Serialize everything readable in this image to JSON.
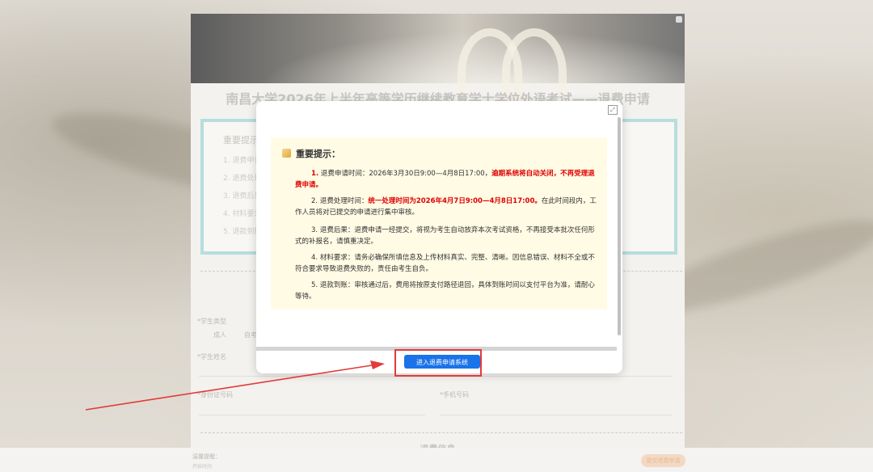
{
  "page": {
    "title": "南昌大学2026年上半年高等学历继续教育学士学位外语考试——退费申请",
    "notice_title": "重要提示：",
    "notice_lines": [
      "1. 退费申请时间",
      "2. 退费处理时间",
      "3. 退费后果",
      "4. 材料要求",
      "5. 退款到账"
    ],
    "field_student_type": "*学生类型",
    "field_student_type_options": [
      "成人",
      "自考"
    ],
    "field_student_name": "*学生姓名",
    "field_id_number": "*身份证号码",
    "field_phone": "*手机号码",
    "section_refund_info": "退费信息",
    "footer_line1": "温馨提醒：",
    "footer_line2": "开始时间",
    "footer_button": "提交退费申请"
  },
  "modal": {
    "heading": "重要提示：",
    "items": [
      {
        "num": "1.",
        "label": "退费申请时间：",
        "text": "2026年3月30日9:00—4月8日17:00，",
        "red": "逾期系统将自动关闭，不再受理退费申请。",
        "tail": ""
      },
      {
        "num": "2.",
        "label": "退费处理时间：",
        "text": "",
        "red": "统一处理时间为2026年4月7日9:00—4月8日17:00。",
        "tail": "在此时间段内，工作人员将对已提交的申请进行集中审核。"
      },
      {
        "num": "3.",
        "label": "退费后果：",
        "text": "退费申请一经提交，将视为考生自动放弃本次考试资格，不再接受本批次任何形式的补报名，请慎重决定。",
        "red": "",
        "tail": ""
      },
      {
        "num": "4.",
        "label": "材料要求：",
        "text": "请务必确保所填信息及上传材料真实、完整、清晰。因信息错误、材料不全或不符合要求导致退费失败的，责任由考生自负。",
        "red": "",
        "tail": ""
      },
      {
        "num": "5.",
        "label": "退款到账：",
        "text": "审核通过后，费用将按原支付路径退回，具体到账时间以支付平台为准，请耐心等待。",
        "red": "",
        "tail": ""
      }
    ],
    "enter_button": "进入退费申请系统",
    "expand_icon": "expand-icon"
  },
  "colors": {
    "accent_blue": "#1a73e8",
    "highlight_red": "#e33a3a",
    "notice_bg": "#fffbe5",
    "warning_red": "#e00000"
  }
}
